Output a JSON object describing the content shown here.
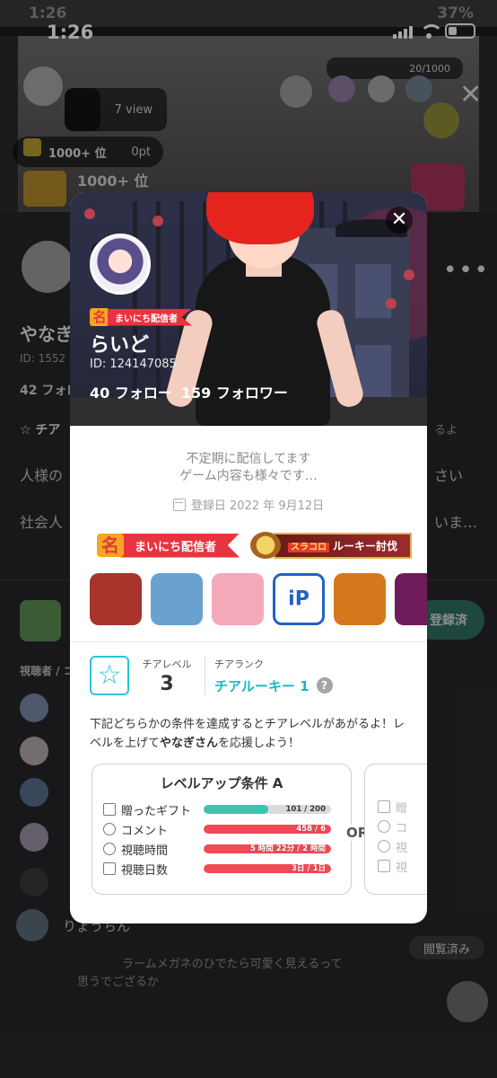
{
  "android_status": {
    "time": "1:26",
    "battery": "37%"
  },
  "status_bar": {
    "time": "1:26"
  },
  "background": {
    "viewer_progress": "20/1000",
    "view_count": "7 view",
    "rank_label": "1000+ 位",
    "points": "0pt",
    "rank_label_2": "1000+ 位",
    "name": "やなぎ",
    "id": "ID: 1552",
    "follow": "42 フォロ",
    "cheer_partial": "☆ チア",
    "text1": "人様の",
    "text1_right": "さい",
    "text2": "社会人",
    "text2_right": "いま…",
    "suffix": "るよ",
    "registered": "登録済",
    "viewers_label": "視聴者 / コ",
    "chat_name": "りょうちん",
    "chat_msg": "ラームメガネのひでたら可愛く見えるって",
    "chat_msg2": "思うでござるか",
    "viewed": "閲覧済み"
  },
  "profile": {
    "daily_badge": "まいにち配信者",
    "daily_mark": "名",
    "name": "らいど",
    "id": "ID: 124147085",
    "following": "40 フォロー",
    "followers": "159 フォロワー",
    "bio_line1": "不定期に配信してます",
    "bio_line2": "ゲーム内容も様々です…",
    "registered": "登録日 2022 年 9月12日",
    "close": "✕"
  },
  "badges": {
    "daily": "まいにち配信者",
    "rookie_tag": "スラコロ",
    "rookie_label": "ルーキー討伐"
  },
  "apps": [
    {
      "icon": "game-app-1-icon",
      "color": "#a8332a"
    },
    {
      "icon": "game-app-2-icon",
      "color": "#6aa2cf"
    },
    {
      "icon": "game-app-3-icon",
      "color": "#f4a9b8"
    },
    {
      "icon": "ibispaint-app-icon",
      "color": "#1f63c8",
      "text": "iP"
    },
    {
      "icon": "game-app-5-icon",
      "color": "#d5781d"
    },
    {
      "icon": "game-app-6-icon",
      "color": "#6e1d5a"
    }
  ],
  "cheer": {
    "level_label": "チアレベル",
    "level": "3",
    "rank_label": "チアランク",
    "rank": "チアルーキー 1",
    "help": "?"
  },
  "info": {
    "line_pre": "下記どちらかの条件を達成するとチアレベルがあがるよ！レベルを上げて",
    "user": "やなぎさん",
    "line_post": "を応援しよう！"
  },
  "condition_a": {
    "title": "レベルアップ条件 A",
    "items": [
      {
        "label": "贈ったギフト",
        "value": "101 / 200",
        "progress": 0.505,
        "color": "#3cc4b0"
      },
      {
        "label": "コメント",
        "value": "458 / 6",
        "progress": 1.0,
        "color": "#ef4a55"
      },
      {
        "label": "視聴時間",
        "value": "5 時間 22分 / 2 時間",
        "progress": 1.0,
        "color": "#ef4a55"
      },
      {
        "label": "視聴日数",
        "value": "3日 / 1日",
        "progress": 1.0,
        "color": "#ef4a55"
      }
    ]
  },
  "or_label": "OR",
  "condition_b": {
    "items": [
      {
        "label": "贈"
      },
      {
        "label": "コ"
      },
      {
        "label": "視"
      },
      {
        "label": "視"
      }
    ]
  }
}
